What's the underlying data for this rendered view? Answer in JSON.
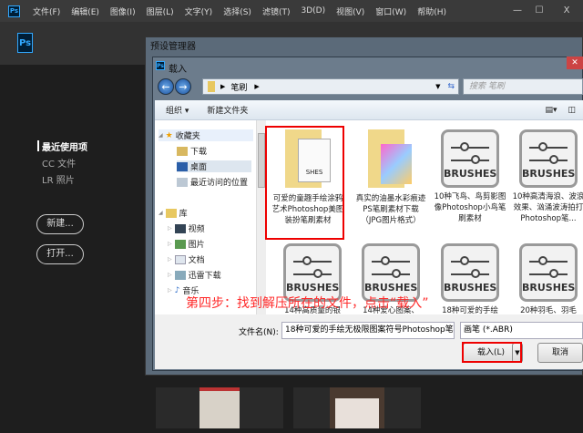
{
  "app": {
    "logo": "Ps",
    "menu": [
      "文件(F)",
      "编辑(E)",
      "图像(I)",
      "图层(L)",
      "文字(Y)",
      "选择(S)",
      "滤镜(T)",
      "3D(D)",
      "视图(V)",
      "窗口(W)",
      "帮助(H)"
    ],
    "controls": [
      "—",
      "☐",
      "X"
    ]
  },
  "start": {
    "nav": [
      "最近使用项",
      "CC 文件",
      "LR 照片"
    ],
    "new_button": "新建...",
    "open_button": "打开..."
  },
  "preset_manager": {
    "title": "预设管理器"
  },
  "load_dialog": {
    "title": "载入",
    "breadcrumb": "笔刷",
    "search_placeholder": "搜索 笔刷",
    "organize": "组织 ▾",
    "new_folder": "新建文件夹",
    "nav": {
      "favorites": "收藏夹",
      "downloads": "下载",
      "desktop": "桌面",
      "recent": "最近访问的位置",
      "libraries": "库",
      "videos": "视频",
      "pictures": "图片",
      "documents": "文档",
      "xunlei": "迅雷下载",
      "music": "音乐"
    },
    "files": [
      {
        "name": "可爱的童趣手绘涂鸦艺术Photoshop美图装扮笔刷素材",
        "type": "folder-brush"
      },
      {
        "name": "真实的油墨水彩痕迹PS笔刷素材下载（JPG图片格式）",
        "type": "folder-image"
      },
      {
        "name": "10种飞鸟、鸟剪影图像Photoshop小鸟笔刷素材",
        "type": "brush"
      },
      {
        "name": "10种高清海浪、波浪效果、汹涌波涛拍打Photoshop笔...",
        "type": "brush"
      },
      {
        "name": "14种高质量的银",
        "type": "brush"
      },
      {
        "name": "14种爱心图案、",
        "type": "brush"
      },
      {
        "name": "18种可爱的手绘",
        "type": "brush"
      },
      {
        "name": "20种羽毛、羽毛",
        "type": "brush"
      }
    ],
    "brush_label": "BRUSHES",
    "filename_label": "文件名(N):",
    "filename_value": "18种可爱的手绘无极限图案符号Photoshop笔",
    "filetype": "画笔 (*.ABR)",
    "load_button": "载入(L)",
    "cancel_button": "取消"
  },
  "annotation": "第四步：找到解压所在的文件，点击“载入”"
}
